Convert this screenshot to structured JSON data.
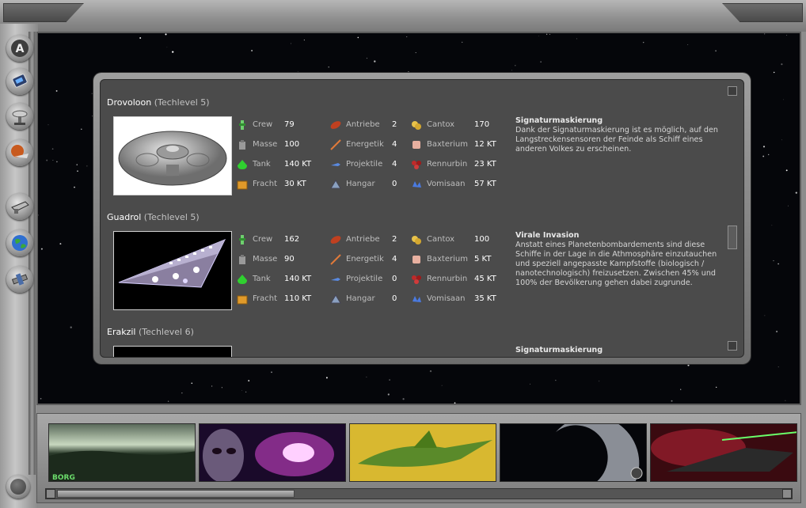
{
  "sidebar": {
    "items": [
      {
        "name": "sidebar-button-a",
        "icon": "letter-a-icon"
      },
      {
        "name": "sidebar-button-handheld",
        "icon": "handheld-device-icon"
      },
      {
        "name": "sidebar-button-satellite",
        "icon": "satellite-dish-icon"
      },
      {
        "name": "sidebar-button-planet-ship",
        "icon": "planet-ship-icon"
      },
      {
        "name": "sidebar-button-phaser",
        "icon": "phaser-icon"
      },
      {
        "name": "sidebar-button-earth",
        "icon": "earth-globe-icon"
      },
      {
        "name": "sidebar-button-station",
        "icon": "space-station-icon"
      },
      {
        "name": "sidebar-button-bottom",
        "icon": "round-button-icon"
      }
    ]
  },
  "labels": {
    "crew": "Crew",
    "masse": "Masse",
    "tank": "Tank",
    "fracht": "Fracht",
    "antriebe": "Antriebe",
    "energetik": "Energetik",
    "projektile": "Projektile",
    "hangar": "Hangar",
    "cantox": "Cantox",
    "baxterium": "Baxterium",
    "rennurbin": "Rennurbin",
    "vomisaan": "Vomisaan"
  },
  "ships": [
    {
      "name": "Drovoloon",
      "techlevel": "(Techlevel 5)",
      "crew": "79",
      "masse": "100",
      "tank": "140 KT",
      "fracht": "30 KT",
      "antriebe": "2",
      "energetik": "4",
      "projektile": "4",
      "hangar": "0",
      "cantox": "170",
      "baxterium": "12 KT",
      "rennurbin": "23 KT",
      "vomisaan": "57 KT",
      "ability_title": "Signaturmaskierung",
      "ability_text": "Dank der Signaturmaskierung ist es möglich, auf den Langstreckensensoren der Feinde als Schiff eines anderen Volkes zu erscheinen."
    },
    {
      "name": "Guadrol",
      "techlevel": "(Techlevel 5)",
      "crew": "162",
      "masse": "90",
      "tank": "140 KT",
      "fracht": "110 KT",
      "antriebe": "2",
      "energetik": "4",
      "projektile": "0",
      "hangar": "0",
      "cantox": "100",
      "baxterium": "5 KT",
      "rennurbin": "45 KT",
      "vomisaan": "35 KT",
      "ability_title": "Virale Invasion",
      "ability_text": "Anstatt eines Planetenbombardements sind diese Schiffe in der Lage in die Athmosphäre einzutauchen und speziell angepasste Kampfstoffe (biologisch / nanotechnologisch) freizusetzen. Zwischen 45% und 100% der Bevölkerung gehen dabei zugrunde."
    },
    {
      "name": "Erakzil",
      "techlevel": "(Techlevel 6)",
      "ability_title": "Signaturmaskierung"
    }
  ],
  "gallery": {
    "items": [
      {
        "name": "thumb-borg",
        "caption": "BORG"
      },
      {
        "name": "thumb-alien-nebula"
      },
      {
        "name": "thumb-green-ship"
      },
      {
        "name": "thumb-death-star"
      },
      {
        "name": "thumb-red-battle"
      }
    ]
  },
  "colors": {
    "panel": "#4b4b4b",
    "frame": "#9a9a9a",
    "space": "#05060a"
  }
}
